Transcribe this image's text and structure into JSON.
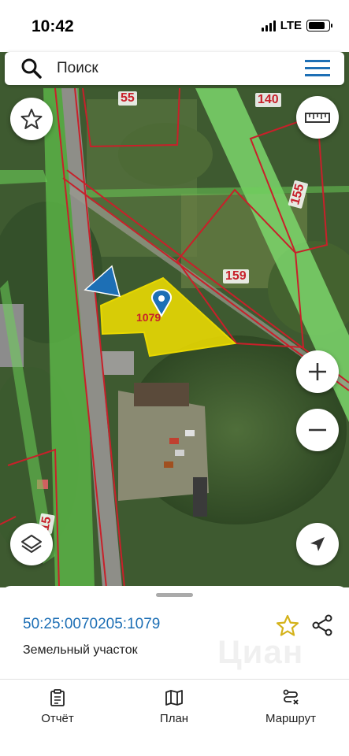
{
  "status_bar": {
    "time": "10:42",
    "network": "LTE",
    "battery_level": 0.85
  },
  "search": {
    "placeholder": "Поиск"
  },
  "map": {
    "plot_labels": [
      "55",
      "140",
      "155",
      "159",
      "1079",
      "15"
    ],
    "selected_plot_color": "#f2e000",
    "boundary_color": "#c8202a",
    "zone_color": "#7bd66b",
    "pin_color": "#1d6fb5"
  },
  "icons": {
    "favorite": "star-outline-icon",
    "ruler": "ruler-icon",
    "zoom_in": "plus-icon",
    "zoom_out": "minus-icon",
    "layers": "layers-icon",
    "locate": "navigation-arrow-icon",
    "menu": "hamburger-menu-icon",
    "search": "search-icon",
    "share": "share-icon"
  },
  "sheet": {
    "cadastral_number": "50:25:0070205:1079",
    "object_type": "Земельный участок",
    "watermark": "Циан"
  },
  "tabs": [
    {
      "label": "Отчёт",
      "icon": "clipboard-icon"
    },
    {
      "label": "План",
      "icon": "map-icon"
    },
    {
      "label": "Маршрут",
      "icon": "route-icon"
    }
  ]
}
